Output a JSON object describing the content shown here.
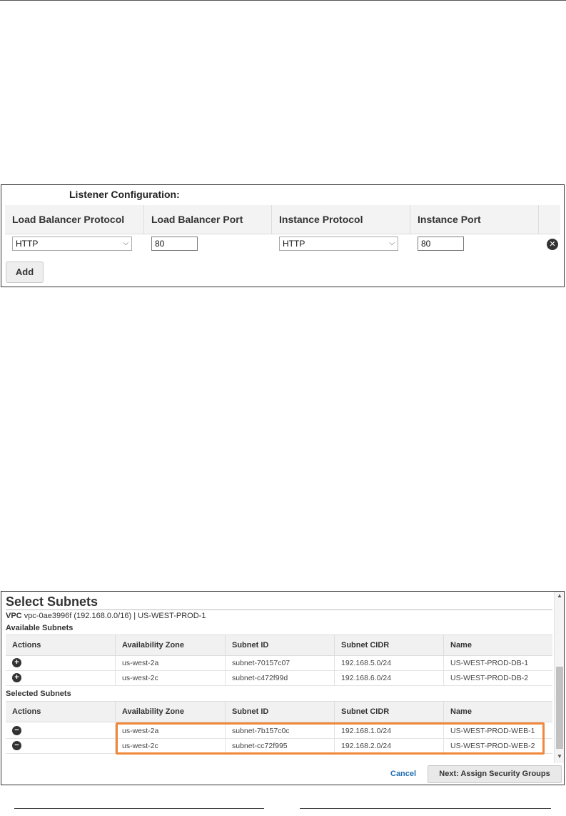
{
  "listener": {
    "title": "Listener Configuration:",
    "columns": [
      "Load Balancer Protocol",
      "Load Balancer Port",
      "Instance Protocol",
      "Instance Port"
    ],
    "row": {
      "lb_protocol": "HTTP",
      "lb_port": "80",
      "instance_protocol": "HTTP",
      "instance_port": "80"
    },
    "add_label": "Add",
    "icons": {
      "remove": "remove-circle-icon",
      "dropdown": "chevron-down-icon"
    }
  },
  "subnets": {
    "title": "Select Subnets",
    "vpc_label": "VPC",
    "vpc_value": "vpc-0ae3996f (192.168.0.0/16) | US-WEST-PROD-1",
    "available_label": "Available Subnets",
    "selected_label": "Selected Subnets",
    "columns": [
      "Actions",
      "Availability Zone",
      "Subnet ID",
      "Subnet CIDR",
      "Name"
    ],
    "available_rows": [
      {
        "zone": "us-west-2a",
        "subnet_id": "subnet-70157c07",
        "cidr": "192.168.5.0/24",
        "name": "US-WEST-PROD-DB-1"
      },
      {
        "zone": "us-west-2c",
        "subnet_id": "subnet-c472f99d",
        "cidr": "192.168.6.0/24",
        "name": "US-WEST-PROD-DB-2"
      }
    ],
    "selected_rows": [
      {
        "zone": "us-west-2a",
        "subnet_id": "subnet-7b157c0c",
        "cidr": "192.168.1.0/24",
        "name": "US-WEST-PROD-WEB-1"
      },
      {
        "zone": "us-west-2c",
        "subnet_id": "subnet-cc72f995",
        "cidr": "192.168.2.0/24",
        "name": "US-WEST-PROD-WEB-2"
      }
    ],
    "cancel_label": "Cancel",
    "next_label": "Next: Assign Security Groups",
    "icons": {
      "add": "plus-circle-icon",
      "remove": "minus-circle-icon"
    },
    "highlight_color": "#f0883a"
  }
}
